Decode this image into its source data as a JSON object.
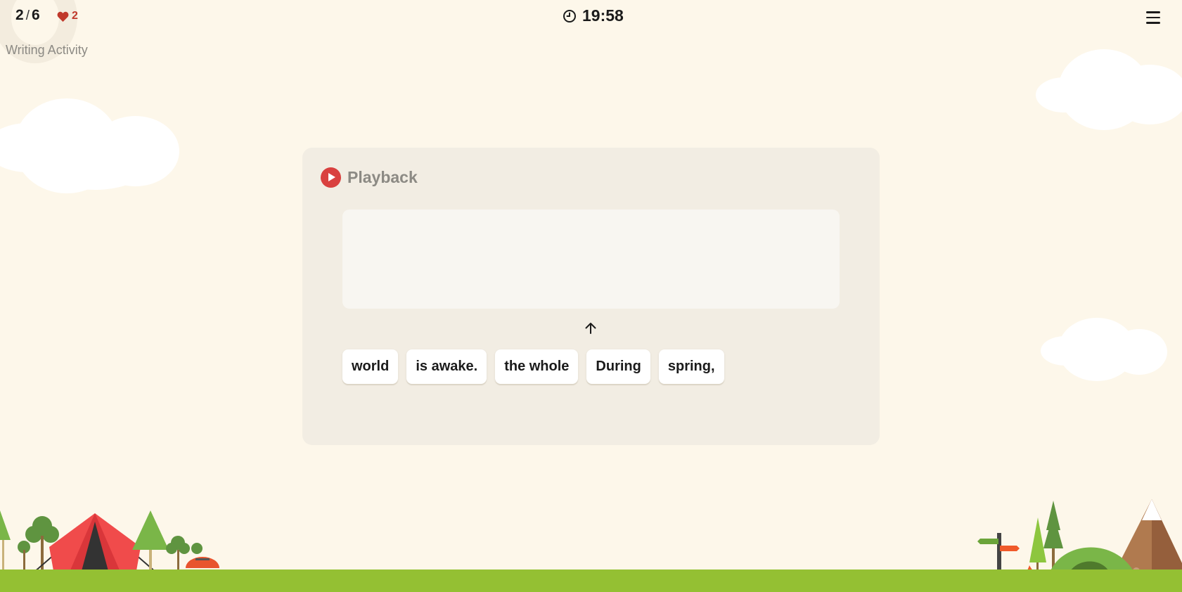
{
  "header": {
    "progress_current": "2",
    "progress_separator": "/",
    "progress_total": "6",
    "lives": "2",
    "activity_title": "Writing Activity",
    "timer": "19:58"
  },
  "card": {
    "playback_label": "Playback",
    "answer_value": "",
    "word_tiles": [
      {
        "label": "world"
      },
      {
        "label": "is awake."
      },
      {
        "label": "the whole"
      },
      {
        "label": "During"
      },
      {
        "label": "spring,"
      }
    ]
  },
  "icons": {
    "lives": "heart-icon",
    "timer": "clock-icon",
    "menu": "hamburger-menu-icon",
    "playback": "play-icon",
    "move_up": "arrow-up-icon"
  },
  "colors": {
    "background": "#fdf7ea",
    "card": "#f2ede3",
    "accent": "#d9413f",
    "ground": "#94c033"
  }
}
